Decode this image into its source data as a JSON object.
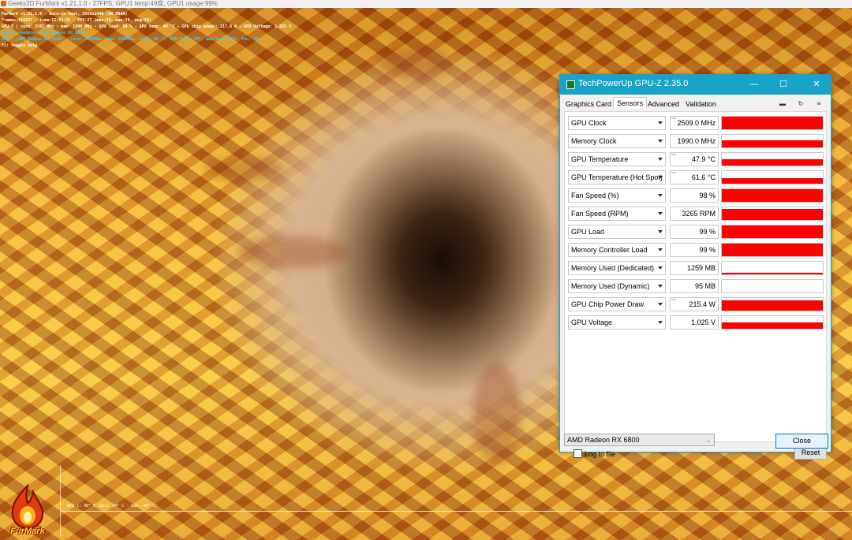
{
  "furmark": {
    "title_bar": "Geeks3D FurMark v1.21.1.0 - 27FPS, GPU1 temp:49度, GPU1 usage:99%",
    "osd": [
      "FurMark v1.21.1.0 - Burn-in test, 2560x1440 (8X MSAA)",
      "Frames:116267 - time:12:13:33 - FPS:27 (max:26, max:28, avg:26)",
      "GPU-Z | core: 2582 MHz - mem: 1990 MHz - GPU load: 99 % - GPU temp: 49 °C - GPU chip power: 217.8 W - GPU Voltage: 1.025 V",
      "OpenGL renderer: AMD Radeon RX 6800",
      "GPU 1 (AMD Radeon RX 6800) - core: 2582MHz, mem: 1990MHz, temp: 48 °C, GPU load: 99%, mem load: 99%, fan: 98%",
      "F1: toggle help"
    ],
    "graph_label": "GPU 1: 48° C (min: 34° C - max: 48° C)",
    "logo_text": "FurMark"
  },
  "gpuz": {
    "title": "TechPowerUp GPU-Z 2.35.0",
    "tabs": [
      "Graphics Card",
      "Sensors",
      "Advanced",
      "Validation"
    ],
    "active_tab": "Sensors",
    "sensors": [
      {
        "name": "GPU Clock",
        "value": "2509.0 MHz",
        "level": 1.0,
        "max": true
      },
      {
        "name": "Memory Clock",
        "value": "1990.0 MHz",
        "level": 0.55,
        "max": false
      },
      {
        "name": "GPU Temperature",
        "value": "47.9 °C",
        "level": 0.5,
        "max": true
      },
      {
        "name": "GPU Temperature (Hot Spot)",
        "value": "61.6 °C",
        "level": 0.45,
        "max": true
      },
      {
        "name": "Fan Speed (%)",
        "value": "98 %",
        "level": 0.98,
        "max": false
      },
      {
        "name": "Fan Speed (RPM)",
        "value": "3265 RPM",
        "level": 0.85,
        "max": false
      },
      {
        "name": "GPU Load",
        "value": "99 %",
        "level": 0.99,
        "max": false
      },
      {
        "name": "Memory Controller Load",
        "value": "99 %",
        "level": 0.99,
        "max": false
      },
      {
        "name": "Memory Used (Dedicated)",
        "value": "1259 MB",
        "level": 0.1,
        "max": false
      },
      {
        "name": "Memory Used (Dynamic)",
        "value": "95 MB",
        "level": 0.0,
        "max": false
      },
      {
        "name": "GPU Chip Power Draw",
        "value": "215.4 W",
        "level": 0.8,
        "max": true
      },
      {
        "name": "GPU Voltage",
        "value": "1.025 V",
        "level": 0.5,
        "max": false
      }
    ],
    "log_to_file": "Log to file",
    "reset": "Reset",
    "gpu_select": "AMD Radeon RX 6800",
    "close": "Close",
    "accent_color": "#1aa3c9",
    "graph_color": "#ff0000",
    "max_mark": "MAX"
  }
}
